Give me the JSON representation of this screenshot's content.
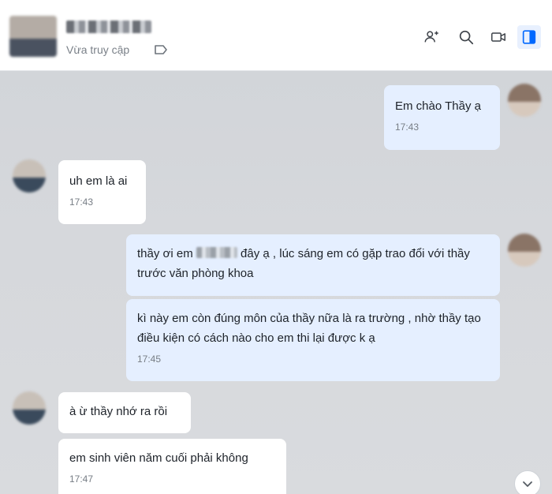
{
  "header": {
    "status": "Vừa truy cập",
    "icons": [
      "add-member-icon",
      "search-icon",
      "video-call-icon",
      "panel-toggle-icon"
    ]
  },
  "colors": {
    "chat_bg": "#d6d8dc",
    "outgoing_bubble": "#e5efff",
    "incoming_bubble": "#ffffff",
    "accent": "#0068ff"
  },
  "messages": [
    {
      "side": "out",
      "text": "Em chào Thầy ạ",
      "time": "17:43"
    },
    {
      "side": "in",
      "text": "uh em là ai",
      "time": "17:43"
    },
    {
      "side": "out",
      "text_before": "thầy ơi em ",
      "text_after": " đây ạ , lúc sáng em có gặp trao đổi với thầy trước văn phòng khoa"
    },
    {
      "side": "out",
      "text": "kì  này em còn đúng môn của thầy nữa là ra trường , nhờ thầy tạo điều kiện có cách nào cho em thi lại được k ạ",
      "time": "17:45"
    },
    {
      "side": "in",
      "text": "à ừ thầy nhớ ra rồi"
    },
    {
      "side": "in",
      "text": "em sinh viên năm cuối phải không",
      "time": "17:47"
    }
  ]
}
